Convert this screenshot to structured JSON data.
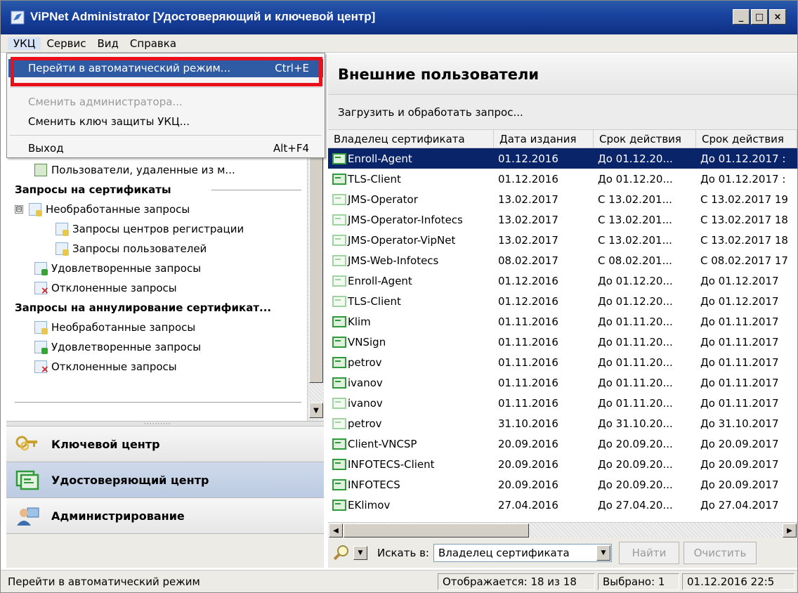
{
  "window": {
    "title": "ViPNet Administrator [Удостоверяющий и ключевой центр]",
    "minimize": "_",
    "maximize": "□",
    "close": "×"
  },
  "menubar": [
    "УКЦ",
    "Сервис",
    "Вид",
    "Справка"
  ],
  "dropdown": {
    "items": [
      {
        "label": "Перейти в автоматический режим...",
        "shortcut": "Ctrl+E",
        "state": "highlighted"
      },
      {
        "label": "Сменить администратора...",
        "shortcut": "",
        "state": "disabled"
      },
      {
        "label": "Сменить ключ защиты УКЦ...",
        "shortcut": "",
        "state": "normal"
      },
      {
        "label": "Выход",
        "shortcut": "Alt+F4",
        "state": "normal"
      }
    ]
  },
  "tree": {
    "items": [
      {
        "label": "Пользователи, удаленные из м...",
        "kind": "users",
        "head": false
      },
      {
        "label": "Запросы на сертификаты",
        "kind": "section",
        "head": true
      },
      {
        "label": "Необработанные запросы",
        "kind": "pending",
        "head": false,
        "expander": "⊟"
      },
      {
        "label": "Запросы центров регистрации",
        "kind": "pending",
        "head": false
      },
      {
        "label": "Запросы пользователей",
        "kind": "pending",
        "head": false
      },
      {
        "label": "Удовлетворенные запросы",
        "kind": "ok",
        "head": false
      },
      {
        "label": "Отклоненные запросы",
        "kind": "rej",
        "head": false
      },
      {
        "label": "Запросы на аннулирование сертификат...",
        "kind": "section",
        "head": true
      },
      {
        "label": "Необработанные запросы",
        "kind": "pending",
        "head": false
      },
      {
        "label": "Удовлетворенные запросы",
        "kind": "ok",
        "head": false
      },
      {
        "label": "Отклоненные запросы",
        "kind": "rej",
        "head": false
      }
    ]
  },
  "nav": {
    "items": [
      {
        "label": "Ключевой центр",
        "icon": "keys-icon",
        "active": false
      },
      {
        "label": "Удостоверяющий центр",
        "icon": "certificate-center-icon",
        "active": true
      },
      {
        "label": "Администрирование",
        "icon": "admin-user-icon",
        "active": false
      }
    ]
  },
  "main": {
    "title": "Внешние пользователи",
    "action": "Загрузить и обработать запрос...",
    "columns": [
      "Владелец сертификата",
      "Дата издания",
      "Срок действия",
      "Срок действия"
    ],
    "rows": [
      {
        "owner": "Enroll-Agent",
        "issued": "01.12.2016",
        "validity": "До 01.12.20...",
        "validity2": "До 01.12.2017 :",
        "icon": "normal",
        "selected": true
      },
      {
        "owner": "TLS-Client",
        "issued": "01.12.2016",
        "validity": "До 01.12.20...",
        "validity2": "До 01.12.2017 :",
        "icon": "normal",
        "selected": false
      },
      {
        "owner": "JMS-Operator",
        "issued": "13.02.2017",
        "validity": "С 13.02.201...",
        "validity2": "С 13.02.2017 19",
        "icon": "faded",
        "selected": false
      },
      {
        "owner": "JMS-Operator-Infotecs",
        "issued": "13.02.2017",
        "validity": "С 13.02.201...",
        "validity2": "С 13.02.2017 18",
        "icon": "faded",
        "selected": false
      },
      {
        "owner": "JMS-Operator-VipNet",
        "issued": "13.02.2017",
        "validity": "С 13.02.201...",
        "validity2": "С 13.02.2017 18",
        "icon": "faded",
        "selected": false
      },
      {
        "owner": "JMS-Web-Infotecs",
        "issued": "08.02.2017",
        "validity": "С 08.02.201...",
        "validity2": "С 08.02.2017 17",
        "icon": "faded",
        "selected": false
      },
      {
        "owner": "Enroll-Agent",
        "issued": "01.12.2016",
        "validity": "До 01.12.20...",
        "validity2": "До 01.12.2017",
        "icon": "faded",
        "selected": false
      },
      {
        "owner": "TLS-Client",
        "issued": "01.12.2016",
        "validity": "До 01.12.20...",
        "validity2": "До 01.12.2017",
        "icon": "faded",
        "selected": false
      },
      {
        "owner": "Klim",
        "issued": "01.11.2016",
        "validity": "До 01.11.20...",
        "validity2": "До 01.11.2017",
        "icon": "normal",
        "selected": false
      },
      {
        "owner": "VNSign",
        "issued": "01.11.2016",
        "validity": "До 01.11.20...",
        "validity2": "До 01.11.2017",
        "icon": "normal",
        "selected": false
      },
      {
        "owner": "petrov",
        "issued": "01.11.2016",
        "validity": "До 01.11.20...",
        "validity2": "До 01.11.2017",
        "icon": "normal",
        "selected": false
      },
      {
        "owner": "ivanov",
        "issued": "01.11.2016",
        "validity": "До 01.11.20...",
        "validity2": "До 01.11.2017",
        "icon": "normal",
        "selected": false
      },
      {
        "owner": "ivanov",
        "issued": "01.11.2016",
        "validity": "До 01.11.20...",
        "validity2": "До 01.11.2017",
        "icon": "faded",
        "selected": false
      },
      {
        "owner": "petrov",
        "issued": "31.10.2016",
        "validity": "До 31.10.20...",
        "validity2": "До 31.10.2017",
        "icon": "faded",
        "selected": false
      },
      {
        "owner": "Client-VNCSP",
        "issued": "20.09.2016",
        "validity": "До 20.09.20...",
        "validity2": "До 20.09.2017",
        "icon": "normal",
        "selected": false
      },
      {
        "owner": "INFOTECS-Client",
        "issued": "20.09.2016",
        "validity": "До 20.09.20...",
        "validity2": "До 20.09.2017",
        "icon": "normal",
        "selected": false
      },
      {
        "owner": "INFOTECS",
        "issued": "20.09.2016",
        "validity": "До 20.09.20...",
        "validity2": "До 20.09.2017",
        "icon": "normal",
        "selected": false
      },
      {
        "owner": "EKlimov",
        "issued": "27.04.2016",
        "validity": "До 27.04.20...",
        "validity2": "До 27.04.2017",
        "icon": "normal",
        "selected": false
      }
    ]
  },
  "search": {
    "label": "Искать в:",
    "field": "Владелец сертификата",
    "find": "Найти",
    "clear": "Очистить"
  },
  "status": {
    "left": "Перейти в автоматический режим",
    "shown": "Отображается: 18 из 18",
    "selected": "Выбрано: 1",
    "datetime": "01.12.2016 22:5"
  },
  "colors": {
    "highlight": "#2f5aa4",
    "selected_row": "#0a246a",
    "annotation_box": "#e8101a"
  }
}
